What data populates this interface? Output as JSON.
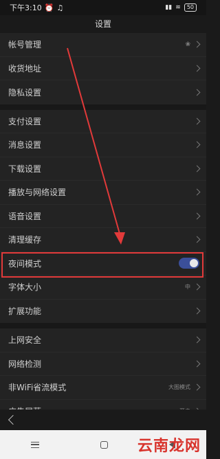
{
  "status": {
    "time": "下午3:10",
    "battery": "50"
  },
  "header": {
    "title": "设置"
  },
  "groups": [
    [
      {
        "label": "帐号管理",
        "icon": "paw-icon"
      },
      {
        "label": "收货地址"
      },
      {
        "label": "隐私设置"
      }
    ],
    [
      {
        "label": "支付设置"
      },
      {
        "label": "消息设置"
      },
      {
        "label": "下载设置"
      },
      {
        "label": "播放与网络设置"
      },
      {
        "label": "语音设置"
      },
      {
        "label": "清理缓存"
      },
      {
        "label": "夜间模式",
        "toggle": true
      },
      {
        "label": "字体大小",
        "value": "中"
      },
      {
        "label": "扩展功能"
      }
    ],
    [
      {
        "label": "上网安全"
      },
      {
        "label": "网络检测"
      },
      {
        "label": "非WiFi省流模式",
        "value": "大图模式"
      },
      {
        "label": "广告屏蔽",
        "value": "开启"
      }
    ]
  ],
  "night_mode": {
    "enabled": true
  },
  "watermark": "云南龙网",
  "colors": {
    "highlight": "#e23a3a",
    "toggle_on": "#3b4f9a",
    "watermark": "#d8342d"
  }
}
